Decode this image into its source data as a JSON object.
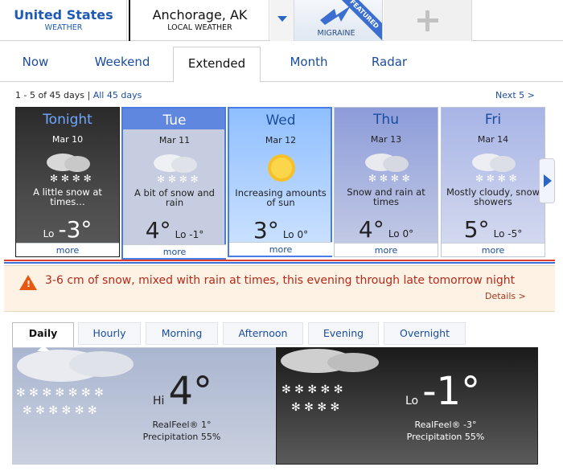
{
  "header": {
    "country": {
      "title": "United States",
      "subtitle": "WEATHER"
    },
    "city": {
      "title": "Anchorage, AK",
      "subtitle": "LOCAL WEATHER"
    },
    "migraine": {
      "label": "MIGRAINE",
      "ribbon": "FEATURED"
    }
  },
  "nav": {
    "tabs": [
      {
        "label": "Now"
      },
      {
        "label": "Weekend"
      },
      {
        "label": "Extended"
      },
      {
        "label": "Month"
      },
      {
        "label": "Radar"
      }
    ],
    "active": "Extended"
  },
  "range": {
    "text": "1 - 5 of 45 days |",
    "all_link": "All 45 days",
    "next": "Next 5 >"
  },
  "days": [
    {
      "day": "Tonight",
      "date": "Mar 10",
      "desc": "A little snow at times…",
      "main": "-3°",
      "prefix": "Lo",
      "suffix": "",
      "more": "more",
      "icon": "snow-cloud-icon"
    },
    {
      "day": "Tue",
      "date": "Mar 11",
      "desc": "A bit of snow and rain",
      "main": "4°",
      "prefix": "",
      "suffix": "Lo -1°",
      "more": "more",
      "icon": "snow-rain-cloud-icon"
    },
    {
      "day": "Wed",
      "date": "Mar 12",
      "desc": "Increasing amounts of sun",
      "main": "3°",
      "prefix": "",
      "suffix": "Lo 0°",
      "more": "more",
      "icon": "sun-icon"
    },
    {
      "day": "Thu",
      "date": "Mar 13",
      "desc": "Snow and rain at times",
      "main": "4°",
      "prefix": "",
      "suffix": "Lo 0°",
      "more": "more",
      "icon": "snow-rain-cloud-icon"
    },
    {
      "day": "Fri",
      "date": "Mar 14",
      "desc": "Mostly cloudy, snow showers",
      "main": "5°",
      "prefix": "",
      "suffix": "Lo -5°",
      "more": "more",
      "icon": "snow-cloud-icon"
    }
  ],
  "alert": {
    "message": "3-6 cm of snow, mixed with rain at times, this evening through late tomorrow night",
    "details": "Details >"
  },
  "period_tabs": [
    {
      "label": "Daily"
    },
    {
      "label": "Hourly"
    },
    {
      "label": "Morning"
    },
    {
      "label": "Afternoon"
    },
    {
      "label": "Evening"
    },
    {
      "label": "Overnight"
    }
  ],
  "day_detail": {
    "hi": {
      "prefix": "Hi",
      "temp": "4°",
      "realfeel": "RealFeel® 1°",
      "precip": "Precipitation 55%"
    },
    "lo": {
      "prefix": "Lo",
      "temp": "-1°",
      "realfeel": "RealFeel® -3°",
      "precip": "Precipitation 55%"
    }
  },
  "colors": {
    "link": "#1a4c9e",
    "alert_text": "#b52a1a",
    "accent_blue": "#4a7be6",
    "accent_red": "#e23c2c"
  }
}
